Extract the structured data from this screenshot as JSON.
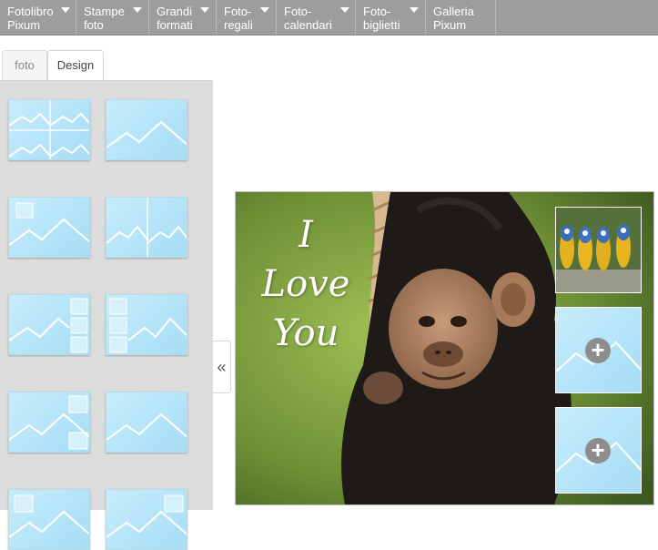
{
  "nav": {
    "items": [
      {
        "label1": "Fotolibro",
        "label2": "Pixum",
        "has_dropdown": true
      },
      {
        "label1": "Stampe",
        "label2": "foto",
        "has_dropdown": true
      },
      {
        "label1": "Grandi",
        "label2": "formati",
        "has_dropdown": true
      },
      {
        "label1": "Foto-",
        "label2": "regali",
        "has_dropdown": true
      },
      {
        "label1": "Foto-",
        "label2": "calendari",
        "has_dropdown": true
      },
      {
        "label1": "Foto-",
        "label2": "biglietti",
        "has_dropdown": true
      },
      {
        "label1": "Galleria",
        "label2": "Pixum",
        "has_dropdown": false
      }
    ]
  },
  "tabs": {
    "foto": "foto",
    "design": "Design",
    "active": "Design"
  },
  "layouts": {
    "thumbnail_icon": "mountain-placeholder-icon",
    "count_visible": 10
  },
  "collapse_button": {
    "label": "«"
  },
  "canvas": {
    "text": {
      "line1": "I",
      "line2": "Love",
      "line3": "You"
    },
    "slots": {
      "first": "parrots-photo",
      "empty_icon": "plus-icon",
      "plus_label": "+"
    }
  },
  "colors": {
    "nav_bg": "#9d9d9d",
    "panel_bg": "#dcdcdc",
    "placeholder_blue": "#a6ddf5"
  }
}
